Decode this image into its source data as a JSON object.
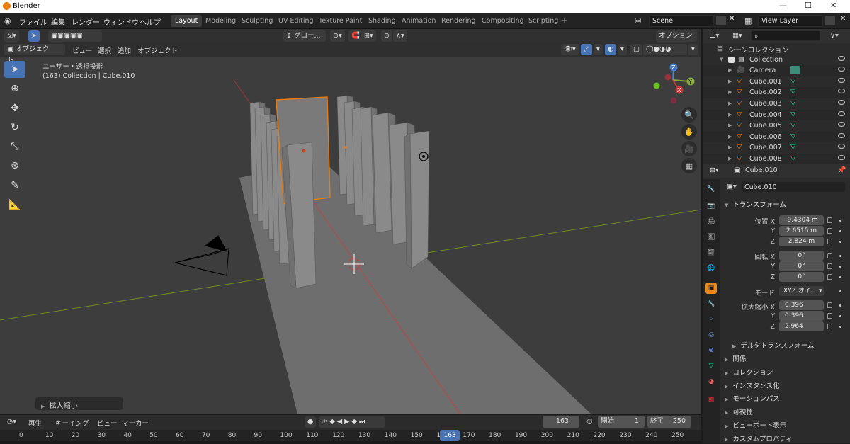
{
  "app_title": "Blender",
  "window_controls": {
    "minimize": "—",
    "maximize": "☐",
    "close": "✕"
  },
  "menus": [
    "ファイル",
    "編集",
    "レンダー",
    "ウィンドウ",
    "ヘルプ"
  ],
  "workspaces": [
    "Layout",
    "Modeling",
    "Sculpting",
    "UV Editing",
    "Texture Paint",
    "Shading",
    "Animation",
    "Rendering",
    "Compositing",
    "Scripting",
    "+"
  ],
  "active_workspace": "Layout",
  "scene": "Scene",
  "view_layer": "View Layer",
  "toolbar": {
    "orientation": "グロー...",
    "options": "オプション"
  },
  "viewport_header": {
    "mode": "オブジェクト...",
    "menus": [
      "ビュー",
      "選択",
      "追加",
      "オブジェクト"
    ]
  },
  "viewport": {
    "view_name": "ユーザー・透視投影",
    "collection_info": "(163) Collection | Cube.010",
    "operator_panel": "拡大縮小"
  },
  "gizmo": {
    "z": "Z",
    "y": "Y",
    "x": "X"
  },
  "timeline": {
    "menus": [
      "再生",
      "キーイング",
      "ビュー",
      "マーカー"
    ],
    "current_frame": "163",
    "start_label": "開始",
    "start": "1",
    "end_label": "終了",
    "end": "250",
    "ruler": [
      "0",
      "10",
      "20",
      "30",
      "40",
      "50",
      "60",
      "70",
      "80",
      "90",
      "100",
      "110",
      "120",
      "130",
      "140",
      "150",
      "160",
      "170",
      "180",
      "190",
      "200",
      "210",
      "220",
      "230",
      "240",
      "250"
    ],
    "ruler_value_max": 260,
    "ruler_cursor_value": 163
  },
  "outliner": {
    "title": "シーンコレクション",
    "items": [
      {
        "name": "Collection",
        "type": "collection"
      },
      {
        "name": "Camera",
        "type": "camera"
      },
      {
        "name": "Cube.001",
        "type": "mesh"
      },
      {
        "name": "Cube.002",
        "type": "mesh"
      },
      {
        "name": "Cube.003",
        "type": "mesh"
      },
      {
        "name": "Cube.004",
        "type": "mesh"
      },
      {
        "name": "Cube.005",
        "type": "mesh"
      },
      {
        "name": "Cube.006",
        "type": "mesh"
      },
      {
        "name": "Cube.007",
        "type": "mesh"
      },
      {
        "name": "Cube.008",
        "type": "mesh"
      }
    ]
  },
  "properties": {
    "context": "Cube.010",
    "object_name": "Cube.010",
    "transform_title": "トランスフォーム",
    "location_label": "位置 X",
    "y_label": "Y",
    "z_label": "Z",
    "location": [
      "-9.4304 m",
      "2.6515 m",
      "2.824 m"
    ],
    "rotation_label": "回転 X",
    "rotation": [
      "0°",
      "0°",
      "0°"
    ],
    "mode_label": "モード",
    "mode": "XYZ オイ...",
    "scale_label": "拡大縮小 X",
    "scale": [
      "0.396",
      "0.396",
      "2.964"
    ],
    "delta": "デルタトランスフォーム",
    "sections": [
      "関係",
      "コレクション",
      "インスタンス化",
      "モーションパス",
      "可視性",
      "ビューポート表示",
      "カスタムプロパティ"
    ]
  },
  "colors": {
    "accent": "#4772b3",
    "selection": "#e87d0d",
    "xaxis": "#c63a3a",
    "yaxis": "#7c9d2a",
    "viewport_bg": "#3d3d3d",
    "mesh_icon": "#2fd18a"
  }
}
